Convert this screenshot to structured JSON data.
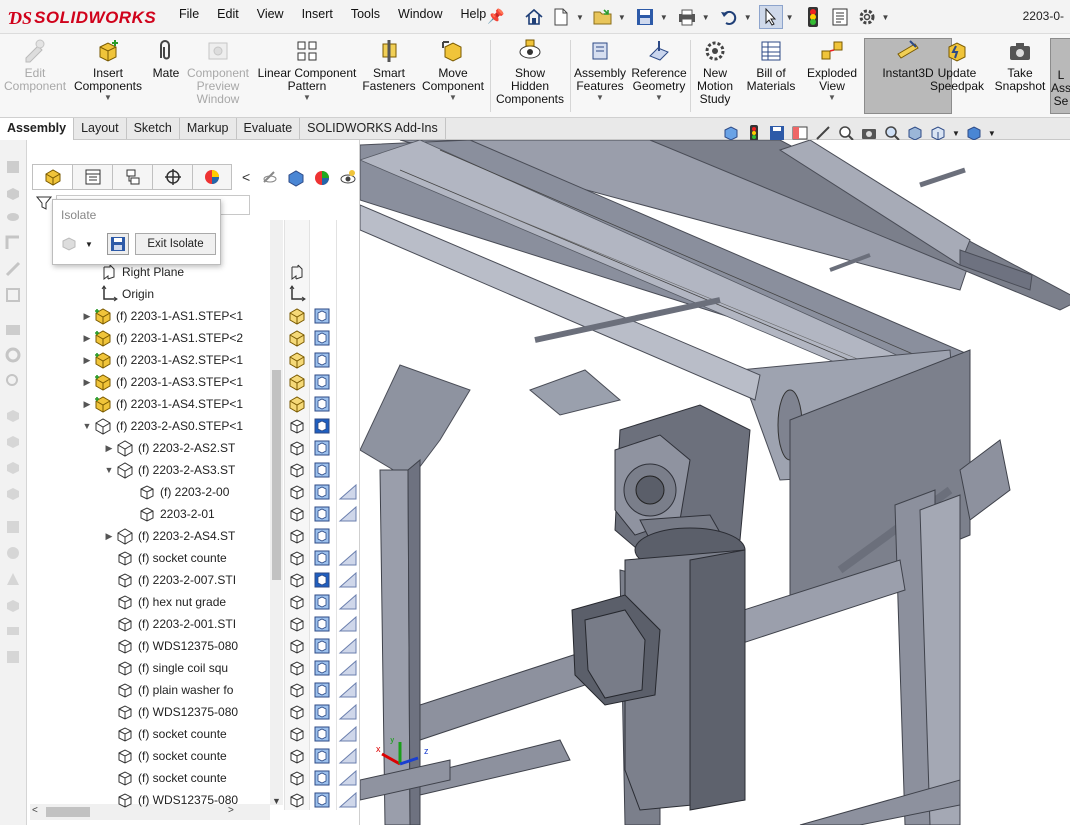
{
  "app": {
    "brand": "SOLIDWORKS",
    "doc_title": "2203-0-"
  },
  "menu": [
    "File",
    "Edit",
    "View",
    "Insert",
    "Tools",
    "Window",
    "Help"
  ],
  "ribbon": [
    {
      "id": "edit-component",
      "label": "Edit\nComponent",
      "enabled": false
    },
    {
      "id": "insert-components",
      "label": "Insert\nComponents",
      "enabled": true,
      "dropdown": true
    },
    {
      "id": "mate",
      "label": "Mate",
      "enabled": true
    },
    {
      "id": "component-preview-window",
      "label": "Component\nPreview\nWindow",
      "enabled": false
    },
    {
      "id": "linear-component-pattern",
      "label": "Linear Component\nPattern",
      "enabled": true,
      "dropdown": true
    },
    {
      "id": "smart-fasteners",
      "label": "Smart\nFasteners",
      "enabled": true
    },
    {
      "id": "move-component",
      "label": "Move\nComponent",
      "enabled": true,
      "dropdown": true
    },
    {
      "id": "show-hidden-components",
      "label": "Show\nHidden\nComponents",
      "enabled": true
    },
    {
      "id": "assembly-features",
      "label": "Assembly\nFeatures",
      "enabled": true,
      "dropdown": true
    },
    {
      "id": "reference-geometry",
      "label": "Reference\nGeometry",
      "enabled": true,
      "dropdown": true
    },
    {
      "id": "new-motion-study",
      "label": "New\nMotion\nStudy",
      "enabled": true
    },
    {
      "id": "bill-of-materials",
      "label": "Bill of\nMaterials",
      "enabled": true
    },
    {
      "id": "exploded-view",
      "label": "Exploded\nView",
      "enabled": true,
      "dropdown": true
    },
    {
      "id": "instant3d",
      "label": "Instant3D",
      "enabled": true,
      "active": true
    },
    {
      "id": "update-speedpak",
      "label": "Update\nSpeedpak",
      "enabled": true
    },
    {
      "id": "take-snapshot",
      "label": "Take\nSnapshot",
      "enabled": true
    },
    {
      "id": "large-assembly-settings",
      "label": "L\nAss\nSe",
      "enabled": true
    }
  ],
  "tabs": [
    "Assembly",
    "Layout",
    "Sketch",
    "Markup",
    "Evaluate",
    "SOLIDWORKS Add-Ins"
  ],
  "active_tab": "Assembly",
  "isolate": {
    "title": "Isolate",
    "exit_label": "Exit Isolate"
  },
  "tree": [
    {
      "label": "Right Plane",
      "indent": 0,
      "type": "plane",
      "expander": ""
    },
    {
      "label": "Origin",
      "indent": 0,
      "type": "origin",
      "expander": ""
    },
    {
      "label": "(f) 2203-1-AS1.STEP<1",
      "indent": 0,
      "type": "asm-yellow",
      "expander": "▶"
    },
    {
      "label": "(f) 2203-1-AS1.STEP<2",
      "indent": 0,
      "type": "asm-yellow",
      "expander": "▶"
    },
    {
      "label": "(f) 2203-1-AS2.STEP<1",
      "indent": 0,
      "type": "asm-yellow",
      "expander": "▶"
    },
    {
      "label": "(f) 2203-1-AS3.STEP<1",
      "indent": 0,
      "type": "asm-yellow",
      "expander": "▶"
    },
    {
      "label": "(f) 2203-1-AS4.STEP<1",
      "indent": 0,
      "type": "asm-yellow",
      "expander": "▶"
    },
    {
      "label": "(f) 2203-2-AS0.STEP<1",
      "indent": 0,
      "type": "asm",
      "expander": "▼"
    },
    {
      "label": "(f) 2203-2-AS2.ST",
      "indent": 1,
      "type": "asm",
      "expander": "▶"
    },
    {
      "label": "(f) 2203-2-AS3.ST",
      "indent": 1,
      "type": "asm",
      "expander": "▼"
    },
    {
      "label": "(f) 2203-2-00",
      "indent": 2,
      "type": "part",
      "expander": ""
    },
    {
      "label": "2203-2-01",
      "indent": 2,
      "type": "part",
      "expander": ""
    },
    {
      "label": "(f) 2203-2-AS4.ST",
      "indent": 1,
      "type": "asm",
      "expander": "▶"
    },
    {
      "label": "(f) socket counte",
      "indent": 1,
      "type": "part",
      "expander": ""
    },
    {
      "label": "(f) 2203-2-007.STI",
      "indent": 1,
      "type": "part",
      "expander": ""
    },
    {
      "label": "(f) hex nut grade",
      "indent": 1,
      "type": "part",
      "expander": ""
    },
    {
      "label": "(f) 2203-2-001.STI",
      "indent": 1,
      "type": "part",
      "expander": ""
    },
    {
      "label": "(f) WDS12375-080",
      "indent": 1,
      "type": "part",
      "expander": ""
    },
    {
      "label": "(f) single coil squ",
      "indent": 1,
      "type": "part",
      "expander": ""
    },
    {
      "label": "(f) plain washer fo",
      "indent": 1,
      "type": "part",
      "expander": ""
    },
    {
      "label": "(f) WDS12375-080",
      "indent": 1,
      "type": "part",
      "expander": ""
    },
    {
      "label": "(f) socket counte",
      "indent": 1,
      "type": "part",
      "expander": ""
    },
    {
      "label": "(f) socket counte",
      "indent": 1,
      "type": "part",
      "expander": ""
    },
    {
      "label": "(f) socket counte",
      "indent": 1,
      "type": "part",
      "expander": ""
    },
    {
      "label": "(f) WDS12375-080",
      "indent": 1,
      "type": "part",
      "expander": ""
    }
  ],
  "triad": {
    "x": "x",
    "y": "y",
    "z": "z"
  },
  "colors": {
    "brand_red": "#d0021b",
    "metal": "#8a8f9d",
    "metal_dark": "#5d616d",
    "metal_light": "#b7bbc7",
    "accent_blue": "#2a6bc4"
  }
}
